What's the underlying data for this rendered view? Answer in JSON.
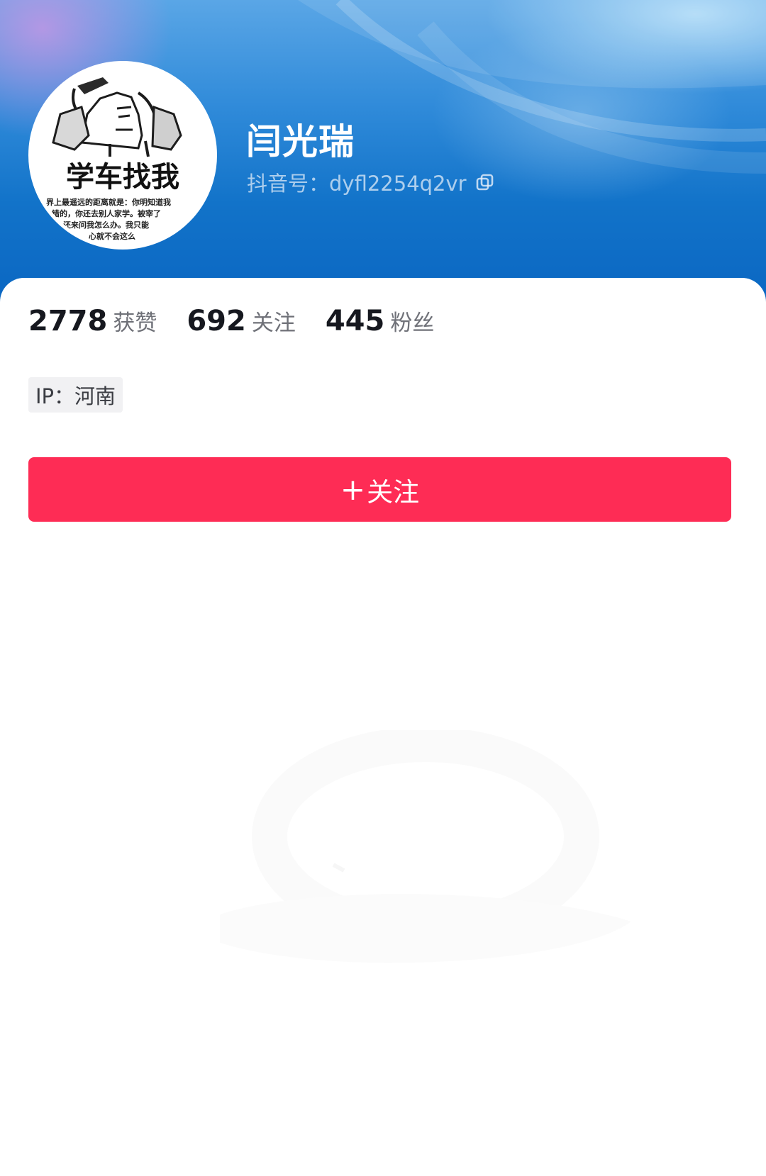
{
  "profile": {
    "name": "闫光瑞",
    "account_id": "抖音号：dyfl2254q2vr",
    "avatar": {
      "caption": "学车找我",
      "small_text": "世界上最遥远的距离就是：你明知道我是教练的，你还去别人家学。被宰了还来问我怎么办。我只能告诉你心就不会这么痛"
    }
  },
  "stats": [
    {
      "value": "2778",
      "label": "获赞"
    },
    {
      "value": "692",
      "label": "关注"
    },
    {
      "value": "445",
      "label": "粉丝"
    }
  ],
  "ip_tag": "IP：河南",
  "follow_button": {
    "label": "关注",
    "icon": "+"
  },
  "icons": {
    "copy": "copy-icon"
  },
  "colors": {
    "accent": "#fe2c55",
    "header_blue": "#0a66c2"
  }
}
